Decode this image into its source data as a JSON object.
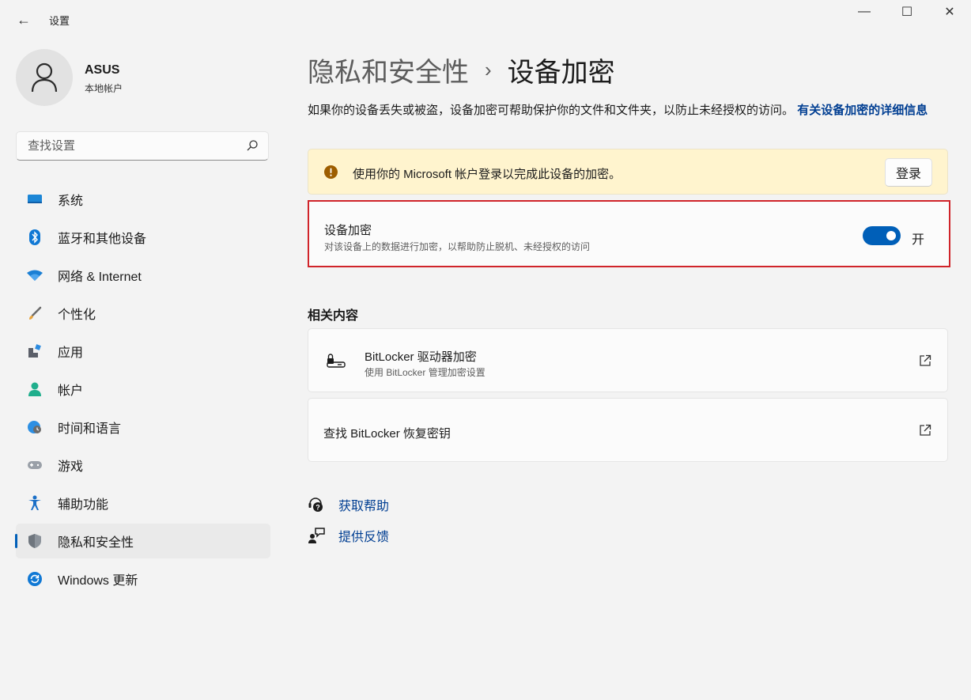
{
  "window": {
    "title": "设置",
    "back_glyph": "←",
    "minimize_glyph": "—",
    "maximize_glyph": "☐",
    "close_glyph": "✕"
  },
  "profile": {
    "name": "ASUS",
    "account_type": "本地帐户"
  },
  "search": {
    "placeholder": "查找设置"
  },
  "sidebar": {
    "items": [
      {
        "label": "系统",
        "icon": "monitor-icon"
      },
      {
        "label": "蓝牙和其他设备",
        "icon": "bluetooth-icon"
      },
      {
        "label": "网络 & Internet",
        "icon": "wifi-icon"
      },
      {
        "label": "个性化",
        "icon": "brush-icon"
      },
      {
        "label": "应用",
        "icon": "apps-icon"
      },
      {
        "label": "帐户",
        "icon": "person-icon"
      },
      {
        "label": "时间和语言",
        "icon": "globe-clock-icon"
      },
      {
        "label": "游戏",
        "icon": "gamepad-icon"
      },
      {
        "label": "辅助功能",
        "icon": "accessibility-icon"
      },
      {
        "label": "隐私和安全性",
        "icon": "shield-icon",
        "active": true
      },
      {
        "label": "Windows 更新",
        "icon": "update-icon"
      }
    ]
  },
  "header": {
    "parent": "隐私和安全性",
    "separator": "›",
    "current": "设备加密"
  },
  "description": {
    "text": "如果你的设备丢失或被盗，设备加密可帮助保护你的文件和文件夹，以防止未经授权的访问。",
    "link": "有关设备加密的详细信息"
  },
  "warning": {
    "text": "使用你的 Microsoft 帐户登录以完成此设备的加密。",
    "button": "登录",
    "color": "#9d5d00"
  },
  "encryption": {
    "title": "设备加密",
    "subtitle": "对该设备上的数据进行加密，以帮助防止脱机、未经授权的访问",
    "toggle_state": "开",
    "enabled": true,
    "accent": "#005fb8",
    "highlight": "#d0242a"
  },
  "related": {
    "title": "相关内容",
    "bitlocker": {
      "title": "BitLocker 驱动器加密",
      "subtitle": "使用 BitLocker 管理加密设置"
    },
    "recovery": {
      "title": "查找 BitLocker 恢复密钥"
    }
  },
  "help": {
    "get_help": "获取帮助",
    "feedback": "提供反馈"
  }
}
